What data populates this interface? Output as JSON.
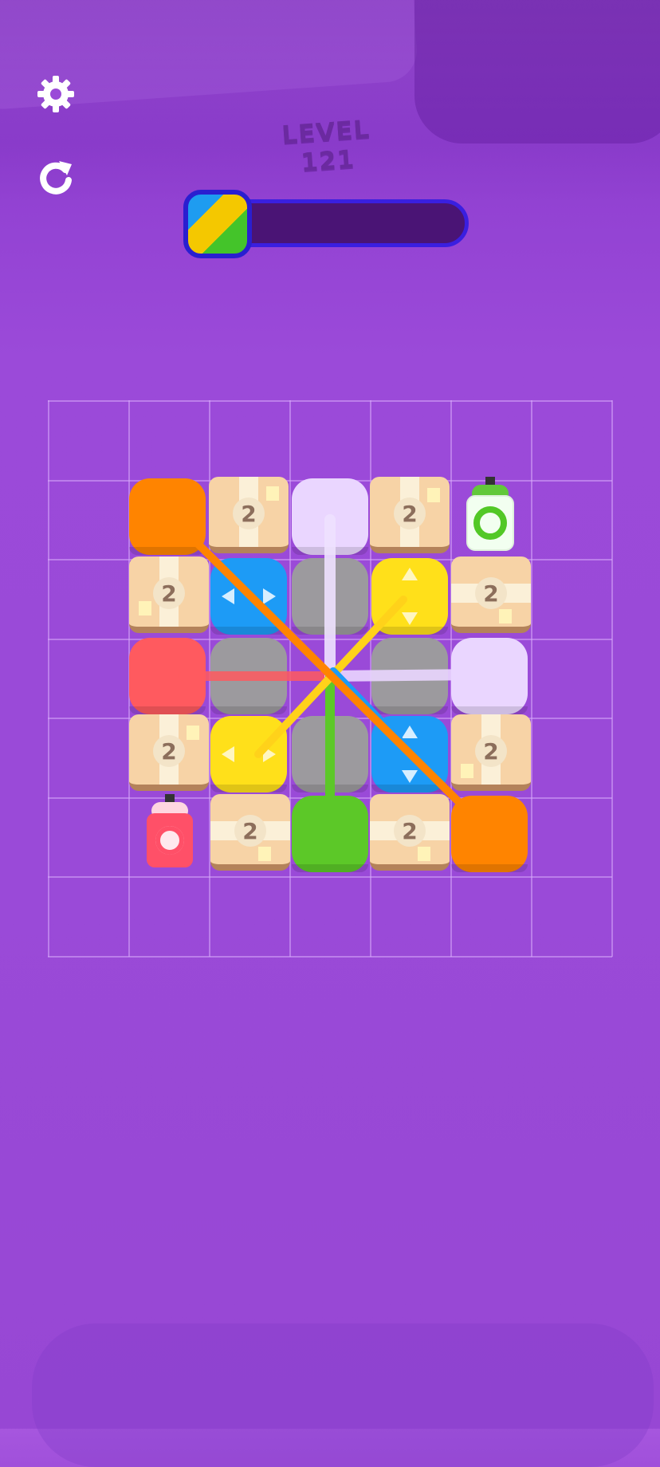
{
  "hud": {
    "level_label": "LEVEL 121",
    "progress_fraction": 0.18,
    "settings_icon": "gear-icon",
    "restart_icon": "restart-icon"
  },
  "colors": {
    "orange": "#ff8400",
    "red": "#ff5a5f",
    "lavender": "#ead6ff",
    "blue": "#1d9bf6",
    "yellow": "#ffe01a",
    "gray": "#9c9a9e",
    "green": "#5cc828",
    "crate": "#f7d3a6"
  },
  "board": {
    "crates": [
      {
        "id": "crate-r0c1",
        "value": "2"
      },
      {
        "id": "crate-r0c3",
        "value": "2"
      },
      {
        "id": "crate-r1c0",
        "value": "2"
      },
      {
        "id": "crate-r1c4",
        "value": "2"
      },
      {
        "id": "crate-r3c0",
        "value": "2"
      },
      {
        "id": "crate-r3c4",
        "value": "2"
      },
      {
        "id": "crate-r4c1",
        "value": "2"
      },
      {
        "id": "crate-r4c3",
        "value": "2"
      }
    ],
    "spools": [
      {
        "id": "green-spool",
        "color": "green"
      },
      {
        "id": "red-spool",
        "color": "red"
      }
    ]
  }
}
